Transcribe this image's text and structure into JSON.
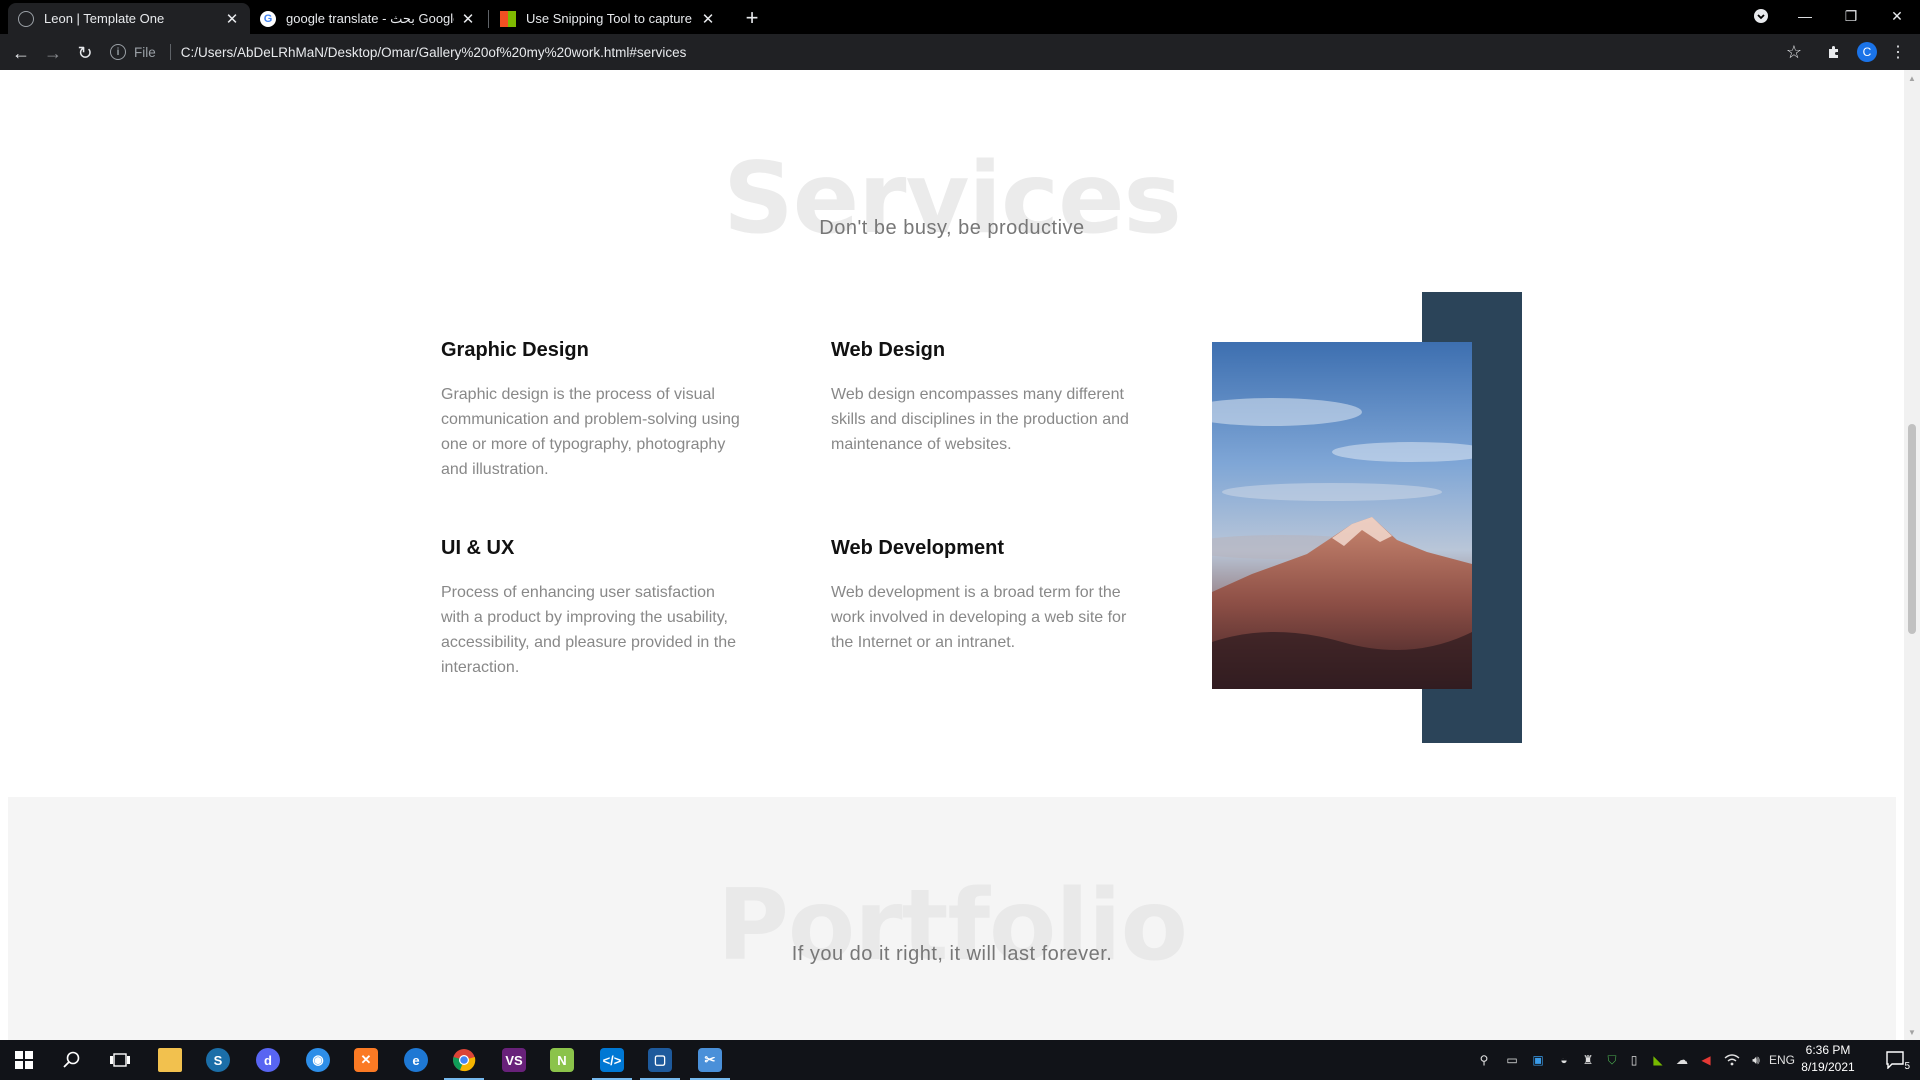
{
  "browser": {
    "tabs": [
      {
        "title": "Leon | Template One",
        "active": true
      },
      {
        "title": "google translate - بحث Google",
        "active": false
      },
      {
        "title": "Use Snipping Tool to capture scr",
        "active": false
      }
    ],
    "new_tab": "+",
    "address": {
      "scheme_label": "File",
      "url": "C:/Users/AbDeLRhMaN/Desktop/Omar/Gallery%20of%20my%20work.html#services"
    },
    "profile_initial": "C"
  },
  "page": {
    "services": {
      "title": "Services",
      "subtitle": "Don't be busy, be productive",
      "items": [
        {
          "title": "Graphic Design",
          "text": "Graphic design is the process of visual communication and problem-solving using one or more of typography, photography and illustration."
        },
        {
          "title": "Web Design",
          "text": "Web design encompasses many different skills and disciplines in the production and maintenance of websites."
        },
        {
          "title": "UI & UX",
          "text": "Process of enhancing user satisfaction with a product by improving the usability, accessibility, and pleasure provided in the interaction."
        },
        {
          "title": "Web Development",
          "text": "Web development is a broad term for the work involved in developing a web site for the Internet or an intranet."
        }
      ]
    },
    "portfolio": {
      "title": "Portfolio",
      "subtitle": "If you do it right, it will last forever."
    }
  },
  "taskbar": {
    "language": "ENG",
    "time": "6:36 PM",
    "date": "8/19/2021",
    "notifications": "5"
  },
  "colors": {
    "accent_block": "#2b4459",
    "title_watermark": "#ebebeb"
  }
}
